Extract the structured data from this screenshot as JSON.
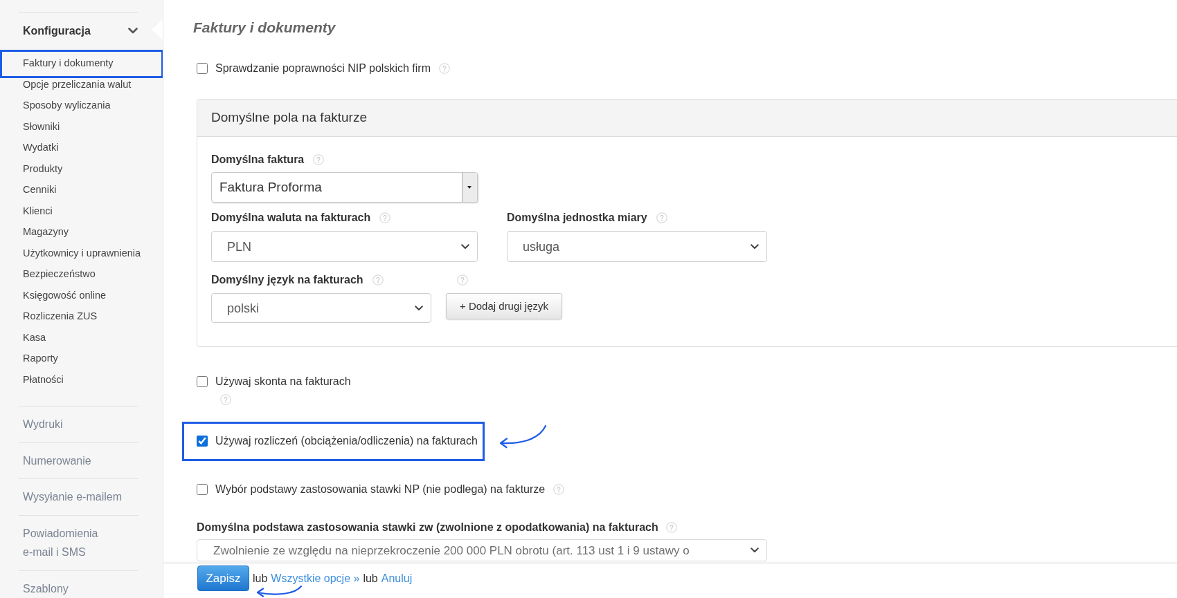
{
  "sidebar": {
    "sections": [
      {
        "label": "Konfiguracja",
        "expanded": true,
        "children": [
          {
            "label": "Faktury i dokumenty",
            "selected": true
          },
          {
            "label": "Opcje przeliczania walut",
            "selected": false
          },
          {
            "label": "Sposoby wyliczania",
            "selected": false
          },
          {
            "label": "Słowniki",
            "selected": false
          },
          {
            "label": "Wydatki",
            "selected": false
          },
          {
            "label": "Produkty",
            "selected": false
          },
          {
            "label": "Cenniki",
            "selected": false
          },
          {
            "label": "Klienci",
            "selected": false
          },
          {
            "label": "Magazyny",
            "selected": false
          },
          {
            "label": "Użytkownicy i uprawnienia",
            "selected": false
          },
          {
            "label": "Bezpieczeństwo",
            "selected": false
          },
          {
            "label": "Księgowość online",
            "selected": false
          },
          {
            "label": "Rozliczenia ZUS",
            "selected": false
          },
          {
            "label": "Kasa",
            "selected": false
          },
          {
            "label": "Raporty",
            "selected": false
          },
          {
            "label": "Płatności",
            "selected": false
          }
        ]
      },
      {
        "label": "Wydruki",
        "expanded": false
      },
      {
        "label": "Numerowanie",
        "expanded": false
      },
      {
        "label": "Wysyłanie e-mailem",
        "expanded": false
      },
      {
        "label": "Powiadomienia e-mail i SMS",
        "expanded": false
      },
      {
        "label": "Szablony",
        "expanded": false
      }
    ]
  },
  "page": {
    "title": "Faktury i dokumenty"
  },
  "settings": [
    {
      "kind": "checkbox",
      "label": "Sprawdzanie poprawności NIP polskich firm",
      "checked": false,
      "help": true,
      "highlighted": false
    },
    {
      "kind": "panel",
      "title": "Domyślne pola na fakturze",
      "rows": [
        [
          {
            "kind": "combobox",
            "label": "Domyślna faktura",
            "help": true,
            "value": "Faktura Proforma"
          }
        ],
        [
          {
            "kind": "select",
            "label": "Domyślna waluta na fakturach",
            "help": true,
            "value": "PLN"
          },
          {
            "kind": "select",
            "label": "Domyślna jednostka miary",
            "help": true,
            "value": "usługa"
          }
        ],
        [
          {
            "kind": "select",
            "label": "Domyślny język na fakturach",
            "help": true,
            "value": "polski"
          },
          {
            "kind": "button",
            "label": "+ Dodaj drugi język",
            "help": true
          }
        ]
      ]
    },
    {
      "kind": "checkbox",
      "label": "Używaj skonta na fakturach",
      "checked": false,
      "help": true,
      "highlighted": false
    },
    {
      "kind": "checkbox",
      "label": "Używaj rozliczeń (obciążenia/odliczenia) na fakturach",
      "checked": true,
      "highlighted": true
    },
    {
      "kind": "checkbox",
      "label": "Wybór podstawy zastosowania stawki NP (nie podlega) na fakturze",
      "checked": false,
      "help": true,
      "highlighted": false
    },
    {
      "kind": "select",
      "label": "Domyślna podstawa zastosowania stawki zw (zwolnione z opodatkowania) na fakturach",
      "help": true,
      "value": "Zwolnienie ze względu na nieprzekroczenie 200 000 PLN obrotu (art. 113 ust 1 i 9 ustawy o"
    }
  ],
  "footer": {
    "save": {
      "label": "Zapisz",
      "highlighted": true
    },
    "parts": [
      {
        "kind": "text",
        "text": "lub"
      },
      {
        "kind": "link",
        "text": "Wszystkie opcje »"
      },
      {
        "kind": "text",
        "text": "lub"
      },
      {
        "kind": "link",
        "text": "Anuluj"
      }
    ]
  }
}
